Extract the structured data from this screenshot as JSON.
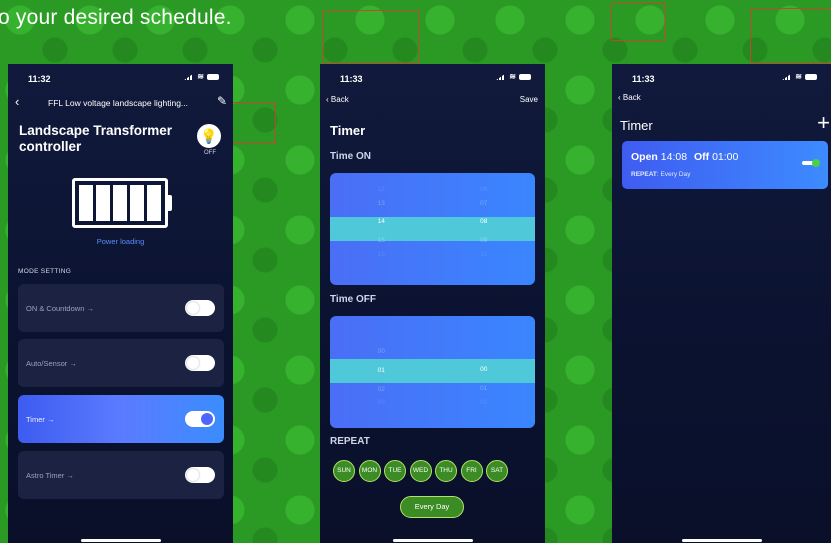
{
  "caption": "o your desired schedule.",
  "phone1": {
    "status_time": "11:32",
    "header_title": "FFL Low voltage landscape lighting...",
    "title": "Landscape Transformer controller",
    "bulb_label": "OFF",
    "power_label": "Power loading",
    "mode_section_label": "MODE SETTING",
    "modes": [
      {
        "label": "ON & Countdown  →",
        "enabled": false
      },
      {
        "label": "Auto/Sensor  →",
        "enabled": false
      },
      {
        "label": "Timer  →",
        "enabled": true
      },
      {
        "label": "Astro Timer  →",
        "enabled": false
      }
    ]
  },
  "phone2": {
    "status_time": "11:33",
    "back_label": "Back",
    "save_label": "Save",
    "title": "Timer",
    "time_on_label": "Time ON",
    "time_on": {
      "hours": [
        "12",
        "13",
        "14",
        "15",
        "16"
      ],
      "minutes": [
        "06",
        "07",
        "08",
        "09",
        "10"
      ],
      "selected_hour": "14",
      "selected_minute": "08"
    },
    "time_off_label": "Time OFF",
    "time_off": {
      "hours": [
        "00",
        "01",
        "02",
        "03"
      ],
      "minutes": [
        "00",
        "01",
        "02"
      ],
      "selected_hour": "01",
      "selected_minute": "00"
    },
    "repeat_label": "REPEAT",
    "days": [
      "SUN",
      "MON",
      "TUE",
      "WED",
      "THU",
      "FRI",
      "SAT"
    ],
    "every_day_label": "Every Day"
  },
  "phone3": {
    "status_time": "11:33",
    "back_label": "Back",
    "title": "Timer",
    "add_symbol": "+",
    "timer": {
      "open_label": "Open",
      "open_time": "14:08",
      "off_label": "Off",
      "off_time": "01:00",
      "repeat_label": "REPEAT",
      "repeat_value": "Every Day",
      "enabled": true
    }
  },
  "colors": {
    "background_green": "#2a9a24",
    "phone_bg": "#0b1230",
    "accent_blue": "#4a6ef5",
    "picker_highlight": "#4fc9da",
    "day_green": "#3b8c24",
    "toggle_on_green": "#49d144"
  },
  "icons": [
    "back-chevron-icon",
    "edit-pencil-icon",
    "lightbulb-icon",
    "battery-icon",
    "signal-icon",
    "wifi-icon",
    "battery-status-icon",
    "plus-icon"
  ]
}
